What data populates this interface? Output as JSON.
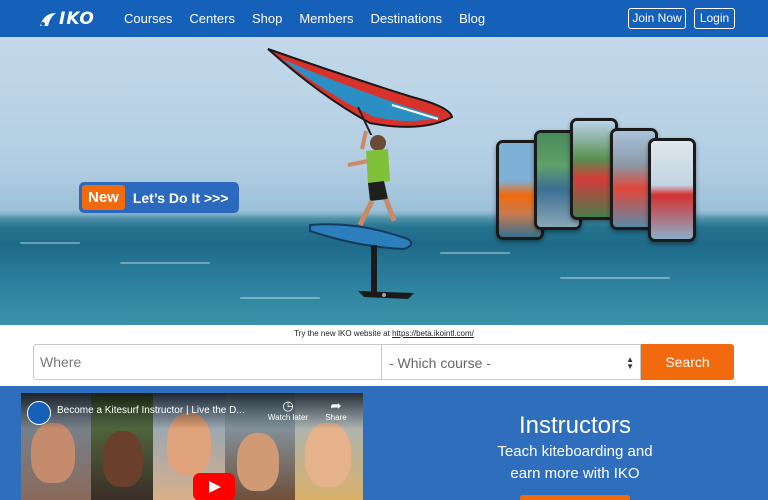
{
  "nav": {
    "logo_text": "IKO",
    "items": [
      {
        "label": "Courses"
      },
      {
        "label": "Centers"
      },
      {
        "label": "Shop"
      },
      {
        "label": "Members"
      },
      {
        "label": "Destinations"
      },
      {
        "label": "Blog"
      }
    ],
    "join_label": "Join Now",
    "login_label": "Login"
  },
  "hero": {
    "badge_new": "New",
    "badge_text": "Let’s Do It >>>"
  },
  "notice": {
    "text": "Try the new IKO website at ",
    "link": "https://beta.ikointl.com/"
  },
  "search": {
    "where_placeholder": "Where",
    "course_selected": "- Which course -",
    "button_label": "Search"
  },
  "video": {
    "title": "Become a Kitesurf Instructor | Live the D...",
    "watch_later": "Watch later",
    "share": "Share"
  },
  "instructors": {
    "title": "Instructors",
    "subtitle_line1": "Teach kiteboarding and",
    "subtitle_line2": "earn more with IKO"
  },
  "colors": {
    "brand_blue": "#1560b8",
    "accent_orange": "#f26a0e",
    "section_blue": "#2e6ebd"
  }
}
